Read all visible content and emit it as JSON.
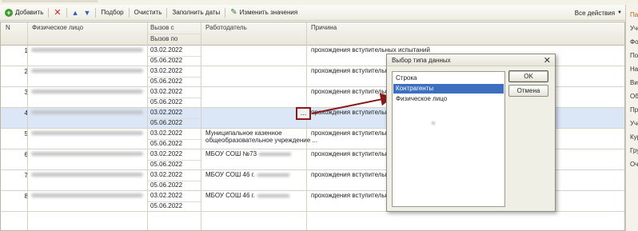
{
  "toolbar": {
    "add_label": "Добавить",
    "select_label": "Подбор",
    "clear_label": "Очистить",
    "fill_dates_label": "Заполнить даты",
    "change_values_label": "Изменить значения",
    "all_actions_label": "Все действия"
  },
  "table": {
    "columns": {
      "n": "N",
      "person": "Физическое лицо",
      "call_from": "Вызов с",
      "call_to": "Вызов по",
      "employer": "Работодатель",
      "reason": "Причина"
    },
    "rows": [
      {
        "n": "1",
        "from": "03.02.2022",
        "to": "05.06.2022",
        "employer": "",
        "employer2": "",
        "reason": "прохождения вступительных испытаний"
      },
      {
        "n": "2",
        "from": "03.02.2022",
        "to": "05.06.2022",
        "employer": "",
        "employer2": "",
        "reason": "прохождения вступительн"
      },
      {
        "n": "3",
        "from": "03.02.2022",
        "to": "05.06.2022",
        "employer": "",
        "employer2": "",
        "reason": "прохождения вступительн"
      },
      {
        "n": "4",
        "from": "03.02.2022",
        "to": "05.06.2022",
        "employer": "",
        "employer2": "",
        "reason": "прохождения вступительн"
      },
      {
        "n": "5",
        "from": "03.02.2022",
        "to": "05.06.2022",
        "employer": "Муниципальное казенное",
        "employer2": "общеобразовательное учреждение ...",
        "reason": "прохождения вступительн"
      },
      {
        "n": "6",
        "from": "03.02.2022",
        "to": "05.06.2022",
        "employer": "МБОУ СОШ №73",
        "employer2": "",
        "reason": "прохождения вступительн"
      },
      {
        "n": "7",
        "from": "03.02.2022",
        "to": "05.06.2022",
        "employer": "МБОУ СОШ 46 г.",
        "employer2": "",
        "reason": "прохождения вступительн"
      },
      {
        "n": "8",
        "from": "03.02.2022",
        "to": "05.06.2022",
        "employer": "МБОУ СОШ 46 г.",
        "employer2": "",
        "reason": "прохождения вступительн"
      }
    ],
    "ellipsis": "..."
  },
  "dialog": {
    "title": "Выбор типа данных",
    "close": "✕",
    "items": [
      "Строка",
      "Контрагенты",
      "Физическое лицо"
    ],
    "selected_index": 1,
    "ok_label": "OK",
    "cancel_label": "Отмена"
  },
  "right_panel": {
    "items": [
      "Па",
      "Уче",
      "Фо",
      "По",
      "На",
      "Ви",
      "Об",
      "Пр",
      "Уче",
      "Кур",
      "Гру",
      "Оч"
    ]
  },
  "colors": {
    "selection": "#dbe7f7",
    "list_selection": "#3d6fc1",
    "arrow": "#8a1a1a"
  }
}
